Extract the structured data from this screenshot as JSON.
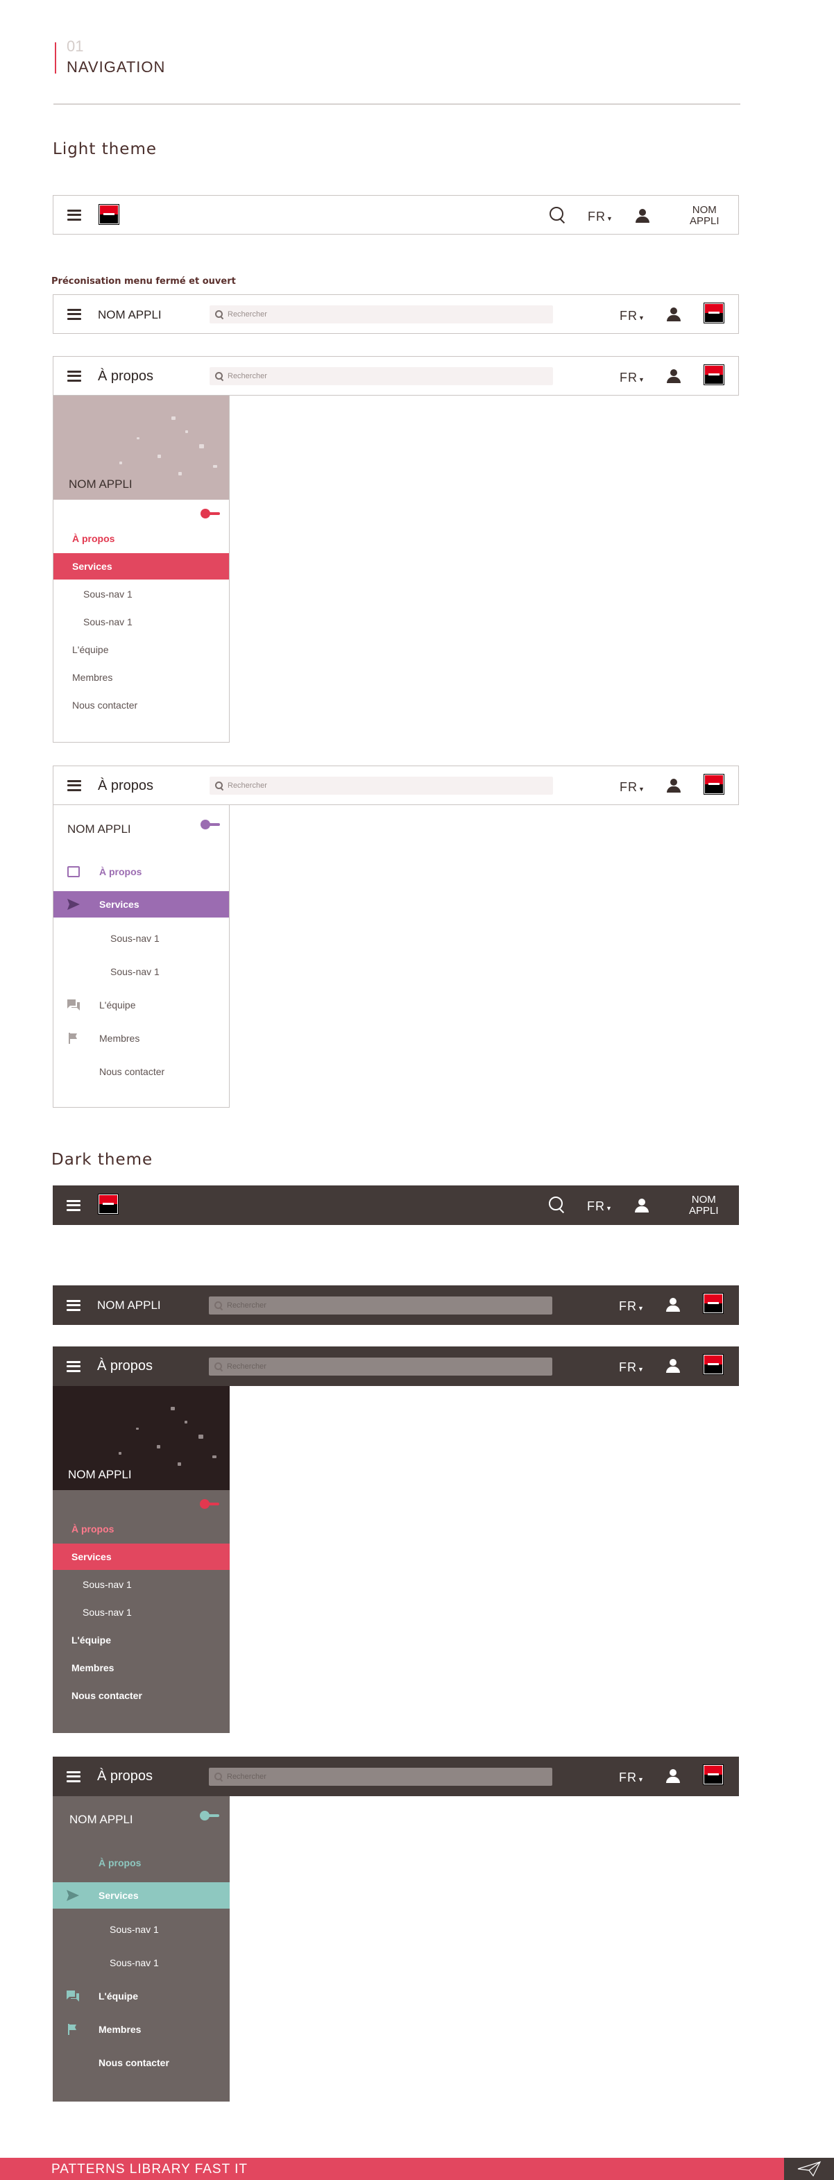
{
  "section": {
    "number": "01",
    "title": "NAVIGATION"
  },
  "themes": {
    "light": "Light theme",
    "dark": "Dark theme"
  },
  "preconisation": "Préconisation menu fermé et ouvert",
  "nav": {
    "app_name_line1": "NOM",
    "app_name_line2": "APPLI",
    "app_name": "NOM APPLI",
    "lang": "FR",
    "search_placeholder": "Rechercher",
    "page_title": "À propos"
  },
  "menu_v1": {
    "header": "NOM APPLI",
    "items": [
      "À propos",
      "Services",
      "Sous-nav 1",
      "Sous-nav 1",
      "L'équipe",
      "Membres",
      "Nous contacter"
    ]
  },
  "menu_v2": {
    "header": "NOM APPLI",
    "items": [
      "À propos",
      "Services",
      "Sous-nav 1",
      "Sous-nav 1",
      "L'équipe",
      "Membres",
      "Nous contacter"
    ]
  },
  "colors": {
    "accent_red": "#e2475f",
    "accent_purple": "#9b6cb1",
    "accent_teal": "#8ec8c0",
    "dark_bar": "#433a38",
    "dark_panel": "#6d6462"
  },
  "footer": {
    "label": "PATTERNS LIBRARY FAST IT"
  }
}
